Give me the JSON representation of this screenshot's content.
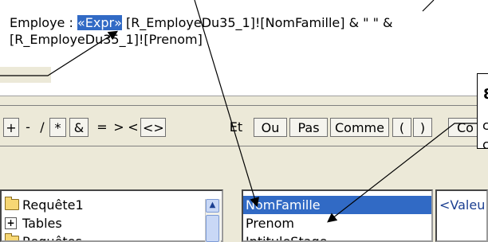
{
  "expression": {
    "prefix": "Employe : ",
    "highlight": "«Expr»",
    "rest_line1": " [R_EmployeDu35_1]![NomFamille] & \" \" &",
    "line2": "[R_EmployeDu35_1]![Prenom]"
  },
  "operators": [
    "+",
    "-",
    "/",
    "*",
    "&",
    "=",
    ">",
    "<",
    "<>",
    "Et",
    "Ou",
    "Pas",
    "Comme",
    "(",
    ")",
    "Co"
  ],
  "tree": {
    "items": [
      {
        "label": "Requête1",
        "icon": "folder-icon"
      },
      {
        "label": "Tables",
        "icon": "plus-icon"
      },
      {
        "label": "Requêtes",
        "icon": "folder-icon"
      }
    ]
  },
  "fields": {
    "items": [
      "NomFamille",
      "Prenom",
      "IntituleStage"
    ],
    "selected_index": 0
  },
  "values": {
    "items": [
      "<Valeu"
    ]
  },
  "callout": {
    "number": "8",
    "c1": "c",
    "c2": "c"
  },
  "colors": {
    "selection": "#316ac5",
    "window_bg": "#ece9d8"
  }
}
